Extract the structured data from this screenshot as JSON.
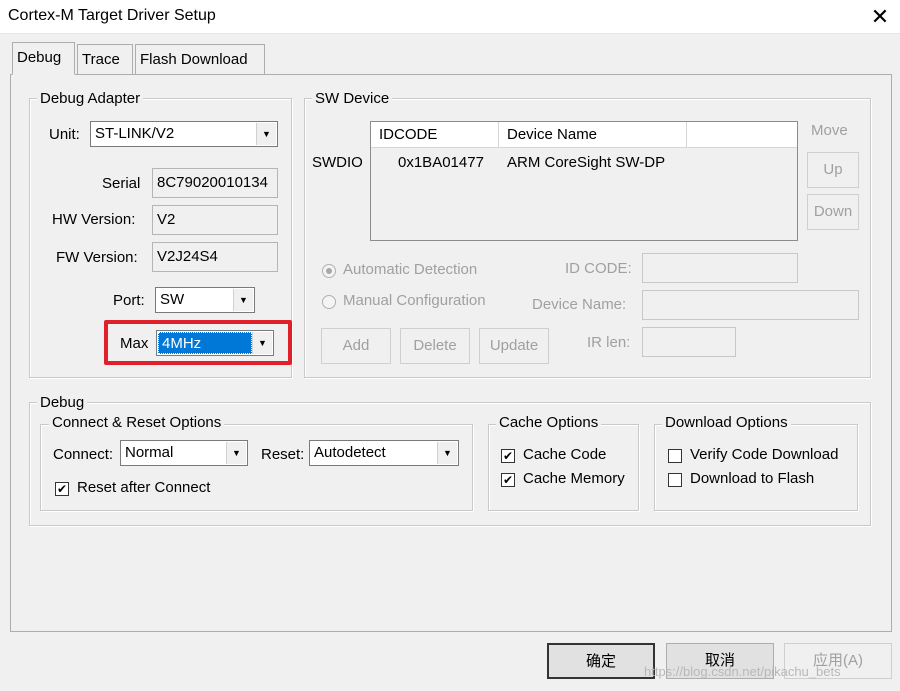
{
  "window": {
    "title": "Cortex-M Target Driver Setup",
    "close_glyph": "✕"
  },
  "tabs": [
    {
      "label": "Debug",
      "active": true
    },
    {
      "label": "Trace",
      "active": false
    },
    {
      "label": "Flash Download",
      "active": false
    }
  ],
  "debug_adapter": {
    "group_title": "Debug Adapter",
    "unit_label": "Unit:",
    "unit_value": "ST-LINK/V2",
    "serial_label": "Serial",
    "serial_value": "8C79020010134",
    "hw_label": "HW Version:",
    "hw_value": "V2",
    "fw_label": "FW Version:",
    "fw_value": "V2J24S4",
    "port_label": "Port:",
    "port_value": "SW",
    "max_label": "Max",
    "max_value": "4MHz"
  },
  "sw_device": {
    "group_title": "SW Device",
    "row_label": "SWDIO",
    "columns": [
      "IDCODE",
      "Device Name"
    ],
    "rows": [
      {
        "idcode": "0x1BA01477",
        "device_name": "ARM CoreSight SW-DP"
      }
    ],
    "move_label": "Move",
    "up_label": "Up",
    "down_label": "Down",
    "auto_detect_label": "Automatic Detection",
    "manual_config_label": "Manual Configuration",
    "id_code_label": "ID CODE:",
    "device_name_label": "Device Name:",
    "ir_len_label": "IR len:",
    "add_label": "Add",
    "delete_label": "Delete",
    "update_label": "Update"
  },
  "debug": {
    "group_title": "Debug",
    "connect_reset": {
      "group_title": "Connect & Reset Options",
      "connect_label": "Connect:",
      "connect_value": "Normal",
      "reset_label": "Reset:",
      "reset_value": "Autodetect",
      "reset_after_connect_label": "Reset after Connect",
      "reset_after_connect_checked": true
    },
    "cache": {
      "group_title": "Cache Options",
      "cache_code_label": "Cache Code",
      "cache_code_checked": true,
      "cache_memory_label": "Cache Memory",
      "cache_memory_checked": true
    },
    "download": {
      "group_title": "Download Options",
      "verify_label": "Verify Code Download",
      "verify_checked": false,
      "download_flash_label": "Download to Flash",
      "download_flash_checked": false
    }
  },
  "footer": {
    "ok_label": "确定",
    "cancel_label": "取消",
    "apply_label": "应用(A)"
  },
  "watermark": "https://blog.csdn.net/pikachu_bets",
  "colors": {
    "highlight": "#e0202a",
    "selection": "#0078d7"
  },
  "icons": {
    "checked_glyph": "✔",
    "dropdown_glyph": "▼"
  }
}
